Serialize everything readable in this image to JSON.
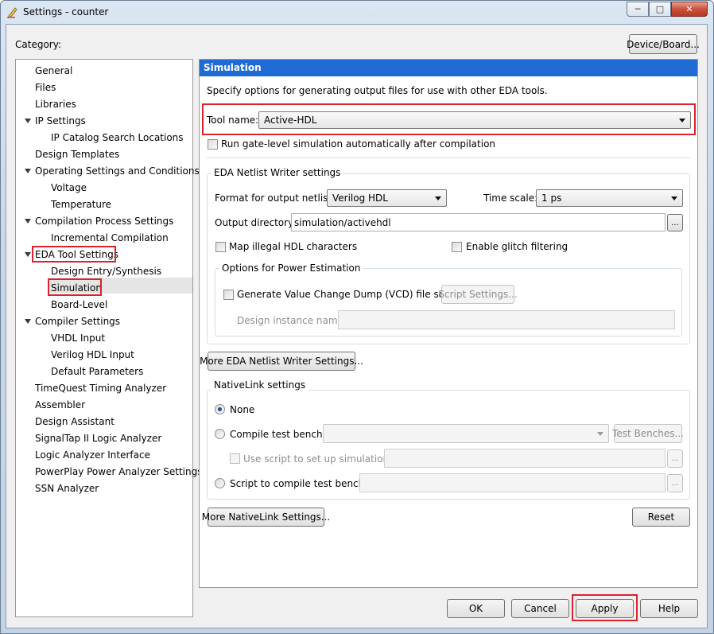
{
  "window": {
    "title": "Settings - counter",
    "icon": "pencil-settings-icon",
    "controls": {
      "minimize": "─",
      "maximize": "□",
      "close": "✕"
    }
  },
  "category_label": "Category:",
  "device_board_button": "Device/Board...",
  "tree": [
    {
      "label": "General",
      "level": 0
    },
    {
      "label": "Files",
      "level": 0
    },
    {
      "label": "Libraries",
      "level": 0
    },
    {
      "label": "IP Settings",
      "level": 0,
      "expanded": true
    },
    {
      "label": "IP Catalog Search Locations",
      "level": 1
    },
    {
      "label": "Design Templates",
      "level": 0
    },
    {
      "label": "Operating Settings and Conditions",
      "level": 0,
      "expanded": true
    },
    {
      "label": "Voltage",
      "level": 1
    },
    {
      "label": "Temperature",
      "level": 1
    },
    {
      "label": "Compilation Process Settings",
      "level": 0,
      "expanded": true
    },
    {
      "label": "Incremental Compilation",
      "level": 1
    },
    {
      "label": "EDA Tool Settings",
      "level": 0,
      "expanded": true,
      "highlighted": true
    },
    {
      "label": "Design Entry/Synthesis",
      "level": 1
    },
    {
      "label": "Simulation",
      "level": 1,
      "selected": true,
      "highlighted": true
    },
    {
      "label": "Board-Level",
      "level": 1
    },
    {
      "label": "Compiler Settings",
      "level": 0,
      "expanded": true
    },
    {
      "label": "VHDL Input",
      "level": 1
    },
    {
      "label": "Verilog HDL Input",
      "level": 1
    },
    {
      "label": "Default Parameters",
      "level": 1
    },
    {
      "label": "TimeQuest Timing Analyzer",
      "level": 0
    },
    {
      "label": "Assembler",
      "level": 0
    },
    {
      "label": "Design Assistant",
      "level": 0
    },
    {
      "label": "SignalTap II Logic Analyzer",
      "level": 0
    },
    {
      "label": "Logic Analyzer Interface",
      "level": 0
    },
    {
      "label": "PowerPlay Power Analyzer Settings",
      "level": 0
    },
    {
      "label": "SSN Analyzer",
      "level": 0
    }
  ],
  "panel": {
    "header": "Simulation",
    "description": "Specify options for generating output files for use with other EDA tools.",
    "tool_name_label": "Tool name:",
    "tool_name_value": "Active-HDL",
    "run_gate_level": {
      "label": "Run gate-level simulation automatically after compilation",
      "checked": false
    },
    "netlist_group": {
      "title": "EDA Netlist Writer settings",
      "format_label": "Format for output netlist:",
      "format_value": "Verilog HDL",
      "time_scale_label": "Time scale:",
      "time_scale_value": "1 ps",
      "output_dir_label": "Output directory:",
      "output_dir_value": "simulation/activehdl",
      "browse": "...",
      "map_illegal": {
        "label": "Map illegal HDL characters",
        "checked": false
      },
      "glitch": {
        "label": "Enable glitch filtering",
        "checked": false
      },
      "power_group": {
        "title": "Options for Power Estimation",
        "vcd": {
          "label": "Generate Value Change Dump (VCD) file script",
          "checked": false
        },
        "script_settings": "Script Settings...",
        "instance_label": "Design instance name:",
        "instance_value": ""
      }
    },
    "more_netlist_button": "More EDA Netlist Writer Settings...",
    "nativelink_group": {
      "title": "NativeLink settings",
      "none_label": "None",
      "compile_tb_label": "Compile test bench:",
      "compile_tb_value": "",
      "test_benches_button": "Test Benches...",
      "use_script_label": "Use script to set up simulation:",
      "use_script_value": "",
      "script_compile_label": "Script to compile test bench:",
      "script_compile_value": "",
      "browse": "...",
      "selected": "None"
    },
    "more_nativelink_button": "More NativeLink Settings...",
    "reset_button": "Reset"
  },
  "footer": {
    "ok": "OK",
    "cancel": "Cancel",
    "apply": "Apply",
    "help": "Help"
  },
  "highlight_color": "#d9232e",
  "header_color": "#1f6bd3"
}
